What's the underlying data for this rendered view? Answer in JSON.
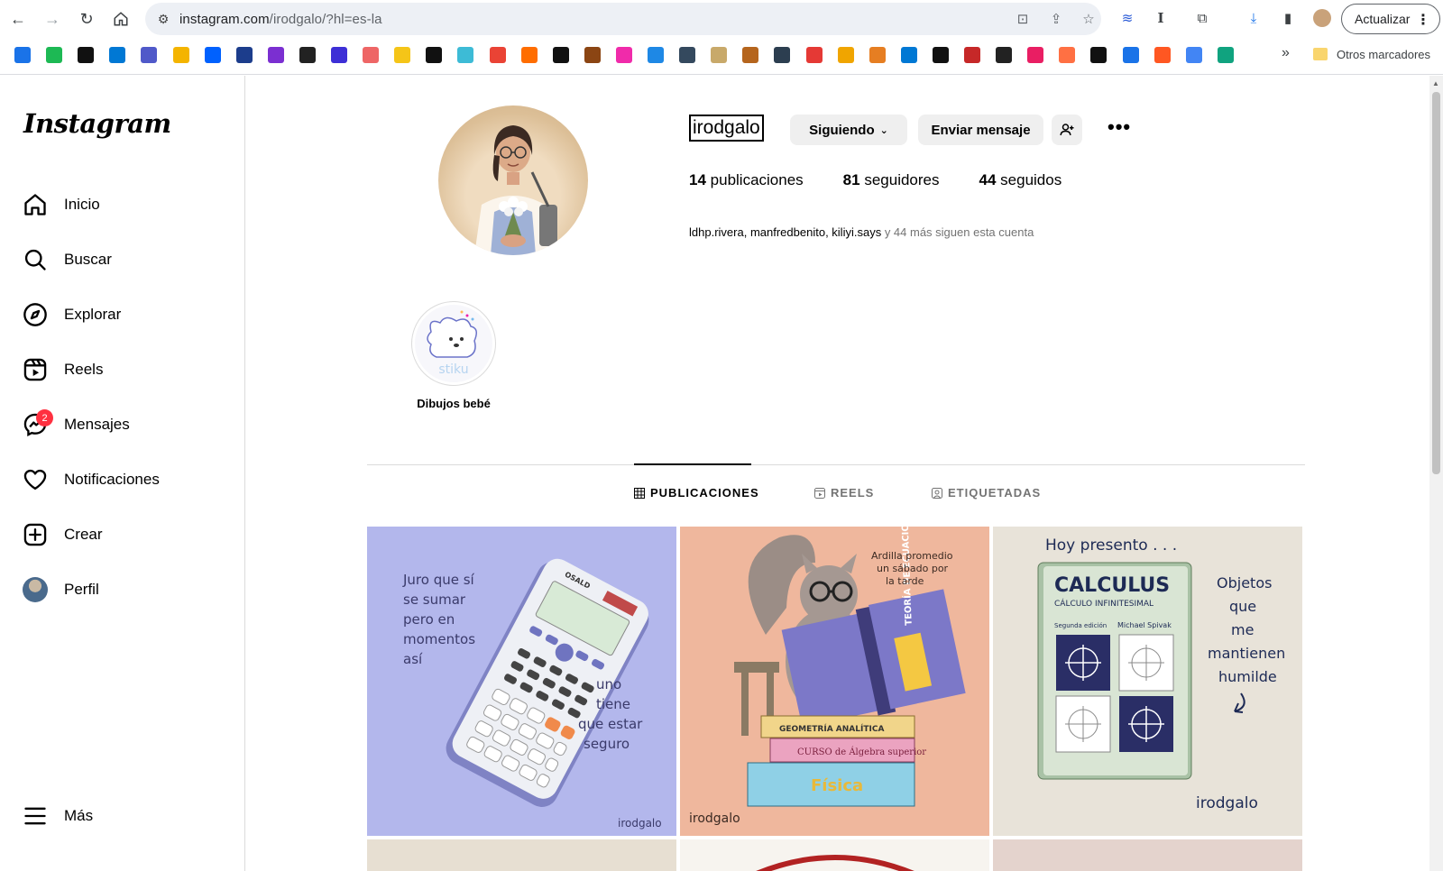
{
  "browser": {
    "url_host": "instagram.com",
    "url_path": "/irodgalo/?hl=es-la",
    "update_label": "Actualizar",
    "other_bookmarks": "Otros marcadores",
    "more_bookmarks": "»"
  },
  "sidebar": {
    "logo": "Instagram",
    "items": [
      {
        "label": "Inicio",
        "icon": "home-icon"
      },
      {
        "label": "Buscar",
        "icon": "search-icon"
      },
      {
        "label": "Explorar",
        "icon": "compass-icon"
      },
      {
        "label": "Reels",
        "icon": "reels-icon"
      },
      {
        "label": "Mensajes",
        "icon": "messenger-icon",
        "badge": "2"
      },
      {
        "label": "Notificaciones",
        "icon": "heart-icon"
      },
      {
        "label": "Crear",
        "icon": "plus-square-icon"
      },
      {
        "label": "Perfil",
        "icon": "avatar"
      }
    ],
    "more": "Más"
  },
  "profile": {
    "username": "irodgalo",
    "following_button": "Siguiendo",
    "message_button": "Enviar mensaje",
    "posts_count": "14",
    "posts_label": "publicaciones",
    "followers_count": "81",
    "followers_label": "seguidores",
    "following_count": "44",
    "following_label": "seguidos",
    "followed_by": [
      "ldhp.rivera",
      "manfredbenito",
      "kiliyi.says"
    ],
    "followed_by_sep": ", ",
    "followed_by_suffix": " y 44 más siguen esta cuenta"
  },
  "highlights": [
    {
      "label": "Dibujos bebé",
      "art_text": "stiku"
    }
  ],
  "tabs": [
    {
      "label": "PUBLICACIONES",
      "active": true,
      "icon": "grid-icon"
    },
    {
      "label": "REELS",
      "active": false,
      "icon": "reels-icon"
    },
    {
      "label": "ETIQUETADAS",
      "active": false,
      "icon": "tag-icon"
    }
  ],
  "posts": [
    {
      "bg": "#b3b7ec",
      "lines_left": [
        "Juro que sí",
        "se sumar",
        "pero en",
        "momentos",
        "así"
      ],
      "lines_right": [
        "uno",
        "tiene",
        "que estar",
        "seguro"
      ],
      "calc_brand": "OSALD",
      "signature": "irodgalo"
    },
    {
      "bg": "#efb79d",
      "caption": [
        "Ardilla promedio",
        "un sábado por",
        "la tarde"
      ],
      "book_title": "TEORÍA DE ECUACIONES",
      "book1": "GEOMETRÍA ANALÍTICA",
      "book2": "CURSO de Álgebra superior",
      "book3": "Física",
      "signature": "irodgalo"
    },
    {
      "bg": "#e8e3d9",
      "header": "Hoy presento . . .",
      "book_title": "CALCULUS",
      "book_subtitle": "CÁLCULO INFINITESIMAL",
      "edition": "Segunda edición",
      "author": "Michael Spivak",
      "side_text": [
        "Objetos",
        "que",
        "me",
        "mantienen",
        "humilde"
      ],
      "signature": "irodgalo"
    }
  ],
  "colors": {
    "badge": "#ff3040",
    "button_gray": "#efefef",
    "divider": "#dbdbdb"
  }
}
